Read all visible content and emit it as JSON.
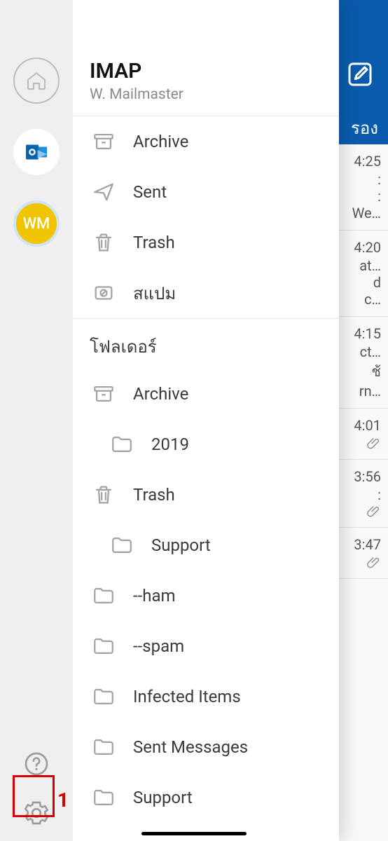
{
  "topbar": {
    "filter_label": "รอง"
  },
  "mini": {
    "avatar_initials": "WM"
  },
  "account": {
    "type": "IMAP",
    "name": "W. Mailmaster"
  },
  "system_folders": [
    {
      "icon": "archive-icon",
      "label": "Archive"
    },
    {
      "icon": "sent-icon",
      "label": "Sent"
    },
    {
      "icon": "trash-icon",
      "label": "Trash"
    },
    {
      "icon": "spam-icon",
      "label": "สแปม"
    }
  ],
  "folders_section_label": "โฟลเดอร์",
  "folders": [
    {
      "icon": "archive-icon",
      "label": "Archive",
      "indent": 0
    },
    {
      "icon": "folder-icon",
      "label": "2019",
      "indent": 1
    },
    {
      "icon": "trash-icon",
      "label": "Trash",
      "indent": 0
    },
    {
      "icon": "folder-icon",
      "label": "Support",
      "indent": 1
    },
    {
      "icon": "folder-icon",
      "label": "--ham",
      "indent": 0
    },
    {
      "icon": "folder-icon",
      "label": "--spam",
      "indent": 0
    },
    {
      "icon": "folder-icon",
      "label": "Infected Items",
      "indent": 0
    },
    {
      "icon": "folder-icon",
      "label": "Sent Messages",
      "indent": 0
    },
    {
      "icon": "folder-icon",
      "label": "Support",
      "indent": 0
    }
  ],
  "mail_peek": [
    {
      "time": "4:25",
      "lines": [
        ":",
        ":",
        "We…"
      ],
      "clip": false
    },
    {
      "time": "4:20",
      "lines": [
        "at…",
        "d",
        " c…"
      ],
      "clip": false
    },
    {
      "time": "4:15",
      "lines": [
        "ct…",
        "ช้",
        "rn…"
      ],
      "clip": false
    },
    {
      "time": "4:01",
      "lines": [
        ""
      ],
      "clip": true
    },
    {
      "time": "3:56",
      "lines": [
        "",
        ":"
      ],
      "clip": true
    },
    {
      "time": "3:47",
      "lines": [
        ""
      ],
      "clip": true
    }
  ],
  "annotation": {
    "number": "1"
  },
  "colors": {
    "brand_blue": "#0a5bac",
    "avatar_yellow": "#f0c400",
    "highlight_red": "#d60000"
  }
}
